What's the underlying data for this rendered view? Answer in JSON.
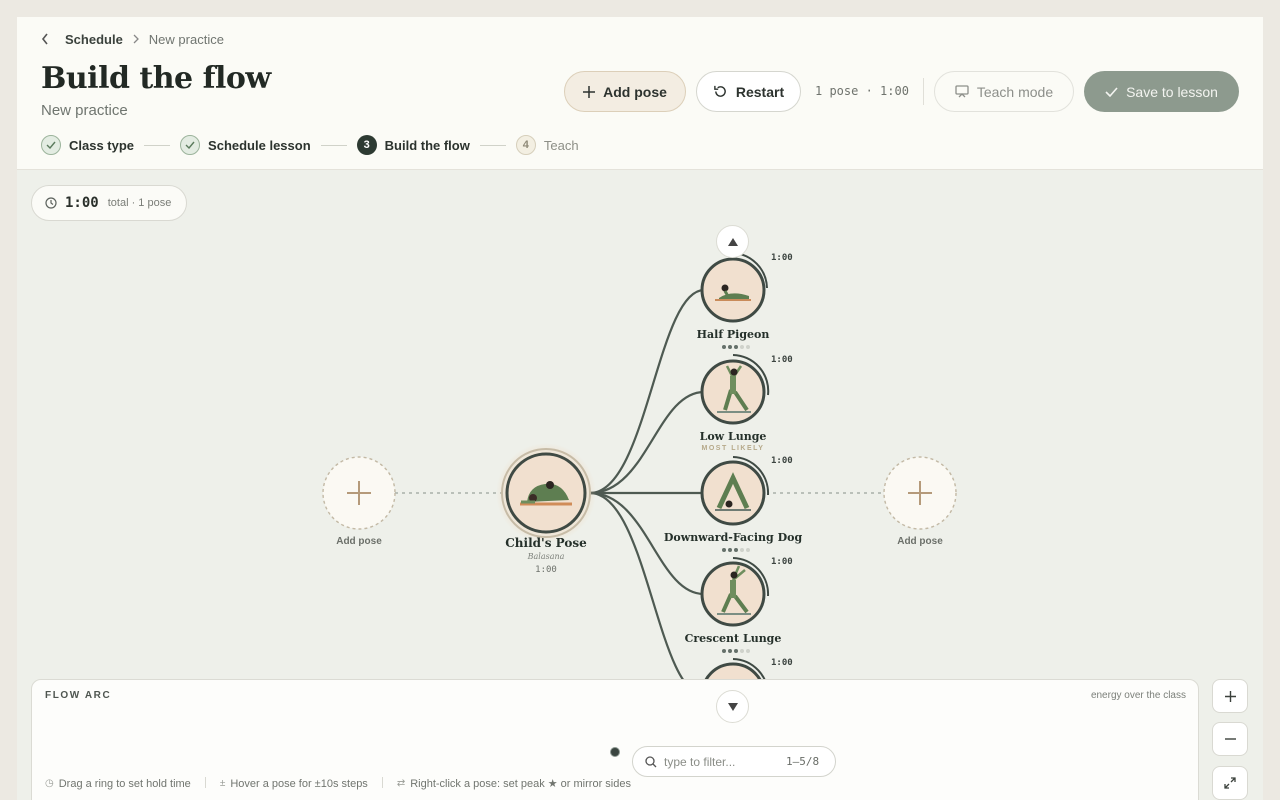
{
  "breadcrumb": {
    "parent": "Schedule",
    "current": "New practice"
  },
  "header": {
    "title": "Build the flow",
    "subtitle": "New practice",
    "add_pose_label": "Add pose",
    "restart_label": "Restart",
    "summary": "1 pose · 1:00",
    "teach_label": "Teach mode",
    "save_label": "Save to lesson"
  },
  "steps": [
    {
      "num": "",
      "label": "Class type",
      "state": "done"
    },
    {
      "num": "",
      "label": "Schedule lesson",
      "state": "done"
    },
    {
      "num": "3",
      "label": "Build the flow",
      "state": "current"
    },
    {
      "num": "4",
      "label": "Teach",
      "state": "todo"
    }
  ],
  "timer": {
    "value": "1:00",
    "suffix": "total · 1 pose"
  },
  "flow": {
    "current_pose": {
      "name": "Child's Pose",
      "sanskrit": "Balasana",
      "duration": "1:00"
    },
    "add_left": "Add pose",
    "add_right": "Add pose",
    "suggestions": [
      {
        "name": "Half Pigeon",
        "duration": "1:00",
        "level": 2,
        "tag": ""
      },
      {
        "name": "Low Lunge",
        "duration": "1:00",
        "level": 2,
        "tag": "MOST LIKELY"
      },
      {
        "name": "Downward-Facing Dog",
        "duration": "1:00",
        "level": 2,
        "tag": ""
      },
      {
        "name": "Crescent Lunge",
        "duration": "1:00",
        "level": 2,
        "tag": ""
      },
      {
        "name": "",
        "duration": "1:00",
        "level": 2,
        "tag": ""
      }
    ]
  },
  "arc": {
    "label": "FLOW ARC",
    "hint": "energy over the class",
    "filter_placeholder": "type to filter...",
    "filter_count": "1–5/8",
    "tips": [
      "Drag a ring to set hold time",
      "Hover a pose for ±10s steps",
      "Right-click a pose: set peak ★ or mirror sides"
    ]
  },
  "icons": {
    "back": "chevron-left-icon",
    "sep": "chevron-right-icon",
    "plus": "plus-icon",
    "restart": "restart-icon",
    "teach": "monitor-icon",
    "save": "check-icon",
    "clock": "clock-icon",
    "search": "search-icon",
    "expand": "expand-icon"
  },
  "colors": {
    "accent": "#2d3a32",
    "save": "#8d9a8e",
    "connector": "#4e5a52",
    "ring": "#3f4a44",
    "pose_fill": "#f1e0cf"
  }
}
